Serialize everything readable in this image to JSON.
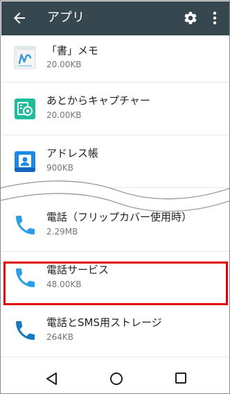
{
  "appbar": {
    "title": "アプリ",
    "back_icon": "arrow-back-icon",
    "settings_icon": "gear-icon",
    "more_icon": "more-vert-icon",
    "background": "#37474f"
  },
  "apps_top": [
    {
      "name": "「書」メモ",
      "size": "20.00KB",
      "icon": "memo-app-icon"
    },
    {
      "name": "あとからキャプチャー",
      "size": "20.00KB",
      "icon": "capture-app-icon"
    },
    {
      "name": "アドレス帳",
      "size": "900KB",
      "icon": "contacts-app-icon"
    }
  ],
  "apps_bottom": [
    {
      "name": "電話（フリップカバー使用時）",
      "size": "2.29MB",
      "icon": "phone-icon"
    },
    {
      "name": "電話サービス",
      "size": "48.00KB",
      "icon": "phone-icon"
    },
    {
      "name": "電話とSMS用ストレージ",
      "size": "264KB",
      "icon": "phone-dark-icon"
    }
  ],
  "highlight_color": "#e00000",
  "navbar": {
    "back_icon": "nav-back-icon",
    "home_icon": "nav-home-icon",
    "recent_icon": "nav-recents-icon"
  }
}
